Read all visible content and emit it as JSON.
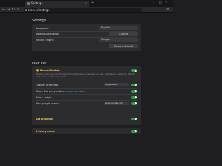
{
  "browser": {
    "tab_label": "Settings",
    "new_tab": "+",
    "tab_close": "×",
    "window": {
      "minimize": "–",
      "maximize": "□",
      "close": "×"
    },
    "nav": {
      "back": "←",
      "forward": "→",
      "reload": "↻",
      "home": "⌂"
    },
    "url": "brave://settings",
    "menu": "≡"
  },
  "settings": {
    "heading": "Settings",
    "rows": [
      {
        "label": "Language",
        "value": "English"
      },
      {
        "label": "Download location",
        "button": "Change"
      },
      {
        "label": "Search engine",
        "value": "Google"
      }
    ],
    "restore_button": "Restore default"
  },
  "features": {
    "heading": "Features",
    "shields": {
      "title": "Brave Shields",
      "description": "Block trackers, ads, and fingerprinting attempts on websites you visit. Shields are enabled by default and can be configured per site.",
      "toggle_on": true
    },
    "rows": [
      {
        "label": "Tracker protection",
        "value": "Aggressive"
      },
      {
        "label": "Block 3rd party cookies",
        "badge": "recommended",
        "toggle_on": true
      },
      {
        "label": "Block scripts",
        "toggle_on": true
      },
      {
        "label": "Use google search",
        "value": "www.google.com",
        "toggle_on": true
      }
    ]
  },
  "ad_blocking": {
    "label": "Ad blocking",
    "toggle_on": true
  },
  "privacy_mode": {
    "label": "Privacy mode",
    "toggle_on": true
  }
}
